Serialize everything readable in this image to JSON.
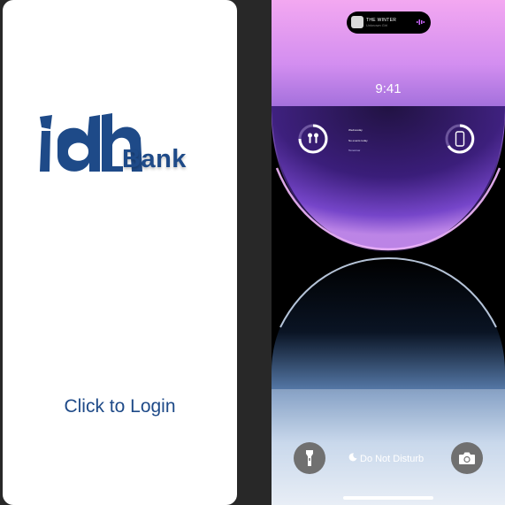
{
  "login_screen": {
    "brand_word": "Bank",
    "login_label": "Click to Login",
    "brand_color": "#1E4A88"
  },
  "lock_screen": {
    "now_playing": {
      "song": "THE WINTER",
      "artist": "Unknown Girl"
    },
    "time": "9:41",
    "widget_left_icon": "airpods-icon",
    "widget_right_icon": "iphone-icon",
    "widget_text": [
      "Wednesday",
      "No events today",
      "Tomorrow"
    ],
    "dnd_label": "Do Not Disturb",
    "flashlight_icon": "flashlight-icon",
    "camera_icon": "camera-icon"
  }
}
